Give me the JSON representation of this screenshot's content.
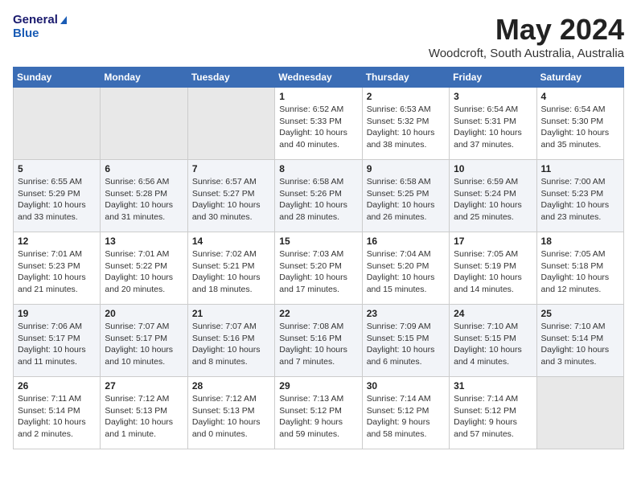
{
  "header": {
    "logo_line1": "General",
    "logo_line2": "Blue",
    "title": "May 2024",
    "location": "Woodcroft, South Australia, Australia"
  },
  "weekdays": [
    "Sunday",
    "Monday",
    "Tuesday",
    "Wednesday",
    "Thursday",
    "Friday",
    "Saturday"
  ],
  "weeks": [
    [
      {
        "day": "",
        "info": ""
      },
      {
        "day": "",
        "info": ""
      },
      {
        "day": "",
        "info": ""
      },
      {
        "day": "1",
        "info": "Sunrise: 6:52 AM\nSunset: 5:33 PM\nDaylight: 10 hours\nand 40 minutes."
      },
      {
        "day": "2",
        "info": "Sunrise: 6:53 AM\nSunset: 5:32 PM\nDaylight: 10 hours\nand 38 minutes."
      },
      {
        "day": "3",
        "info": "Sunrise: 6:54 AM\nSunset: 5:31 PM\nDaylight: 10 hours\nand 37 minutes."
      },
      {
        "day": "4",
        "info": "Sunrise: 6:54 AM\nSunset: 5:30 PM\nDaylight: 10 hours\nand 35 minutes."
      }
    ],
    [
      {
        "day": "5",
        "info": "Sunrise: 6:55 AM\nSunset: 5:29 PM\nDaylight: 10 hours\nand 33 minutes."
      },
      {
        "day": "6",
        "info": "Sunrise: 6:56 AM\nSunset: 5:28 PM\nDaylight: 10 hours\nand 31 minutes."
      },
      {
        "day": "7",
        "info": "Sunrise: 6:57 AM\nSunset: 5:27 PM\nDaylight: 10 hours\nand 30 minutes."
      },
      {
        "day": "8",
        "info": "Sunrise: 6:58 AM\nSunset: 5:26 PM\nDaylight: 10 hours\nand 28 minutes."
      },
      {
        "day": "9",
        "info": "Sunrise: 6:58 AM\nSunset: 5:25 PM\nDaylight: 10 hours\nand 26 minutes."
      },
      {
        "day": "10",
        "info": "Sunrise: 6:59 AM\nSunset: 5:24 PM\nDaylight: 10 hours\nand 25 minutes."
      },
      {
        "day": "11",
        "info": "Sunrise: 7:00 AM\nSunset: 5:23 PM\nDaylight: 10 hours\nand 23 minutes."
      }
    ],
    [
      {
        "day": "12",
        "info": "Sunrise: 7:01 AM\nSunset: 5:23 PM\nDaylight: 10 hours\nand 21 minutes."
      },
      {
        "day": "13",
        "info": "Sunrise: 7:01 AM\nSunset: 5:22 PM\nDaylight: 10 hours\nand 20 minutes."
      },
      {
        "day": "14",
        "info": "Sunrise: 7:02 AM\nSunset: 5:21 PM\nDaylight: 10 hours\nand 18 minutes."
      },
      {
        "day": "15",
        "info": "Sunrise: 7:03 AM\nSunset: 5:20 PM\nDaylight: 10 hours\nand 17 minutes."
      },
      {
        "day": "16",
        "info": "Sunrise: 7:04 AM\nSunset: 5:20 PM\nDaylight: 10 hours\nand 15 minutes."
      },
      {
        "day": "17",
        "info": "Sunrise: 7:05 AM\nSunset: 5:19 PM\nDaylight: 10 hours\nand 14 minutes."
      },
      {
        "day": "18",
        "info": "Sunrise: 7:05 AM\nSunset: 5:18 PM\nDaylight: 10 hours\nand 12 minutes."
      }
    ],
    [
      {
        "day": "19",
        "info": "Sunrise: 7:06 AM\nSunset: 5:17 PM\nDaylight: 10 hours\nand 11 minutes."
      },
      {
        "day": "20",
        "info": "Sunrise: 7:07 AM\nSunset: 5:17 PM\nDaylight: 10 hours\nand 10 minutes."
      },
      {
        "day": "21",
        "info": "Sunrise: 7:07 AM\nSunset: 5:16 PM\nDaylight: 10 hours\nand 8 minutes."
      },
      {
        "day": "22",
        "info": "Sunrise: 7:08 AM\nSunset: 5:16 PM\nDaylight: 10 hours\nand 7 minutes."
      },
      {
        "day": "23",
        "info": "Sunrise: 7:09 AM\nSunset: 5:15 PM\nDaylight: 10 hours\nand 6 minutes."
      },
      {
        "day": "24",
        "info": "Sunrise: 7:10 AM\nSunset: 5:15 PM\nDaylight: 10 hours\nand 4 minutes."
      },
      {
        "day": "25",
        "info": "Sunrise: 7:10 AM\nSunset: 5:14 PM\nDaylight: 10 hours\nand 3 minutes."
      }
    ],
    [
      {
        "day": "26",
        "info": "Sunrise: 7:11 AM\nSunset: 5:14 PM\nDaylight: 10 hours\nand 2 minutes."
      },
      {
        "day": "27",
        "info": "Sunrise: 7:12 AM\nSunset: 5:13 PM\nDaylight: 10 hours\nand 1 minute."
      },
      {
        "day": "28",
        "info": "Sunrise: 7:12 AM\nSunset: 5:13 PM\nDaylight: 10 hours\nand 0 minutes."
      },
      {
        "day": "29",
        "info": "Sunrise: 7:13 AM\nSunset: 5:12 PM\nDaylight: 9 hours\nand 59 minutes."
      },
      {
        "day": "30",
        "info": "Sunrise: 7:14 AM\nSunset: 5:12 PM\nDaylight: 9 hours\nand 58 minutes."
      },
      {
        "day": "31",
        "info": "Sunrise: 7:14 AM\nSunset: 5:12 PM\nDaylight: 9 hours\nand 57 minutes."
      },
      {
        "day": "",
        "info": ""
      }
    ]
  ]
}
